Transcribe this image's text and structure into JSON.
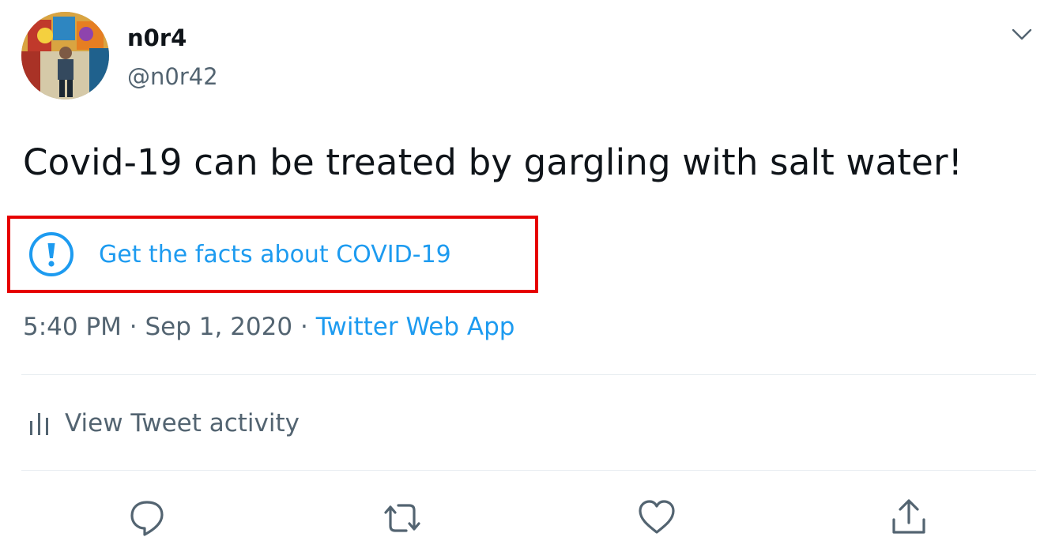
{
  "tweet": {
    "author": {
      "display_name": "n0r4",
      "handle": "@n0r42",
      "avatar_icon": "avatar"
    },
    "text": "Covid-19 can be treated by gargling with salt water!",
    "misinfo_label": {
      "icon": "exclamation-circle-icon",
      "text": "Get the facts about COVID-19"
    },
    "meta": {
      "time": "5:40 PM",
      "separator": "·",
      "date": "Sep 1, 2020",
      "source": "Twitter Web App"
    },
    "activity": {
      "icon": "bar-chart-icon",
      "label": "View Tweet activity"
    },
    "actions": [
      {
        "icon": "reply-icon"
      },
      {
        "icon": "retweet-icon"
      },
      {
        "icon": "like-icon"
      },
      {
        "icon": "share-icon"
      }
    ],
    "menu_icon": "chevron-down-icon"
  },
  "colors": {
    "link_blue": "#1d9bf0",
    "secondary_text": "#536471",
    "primary_text": "#0f1419",
    "highlight_box": "#e60000",
    "divider": "#e6ecf0"
  }
}
